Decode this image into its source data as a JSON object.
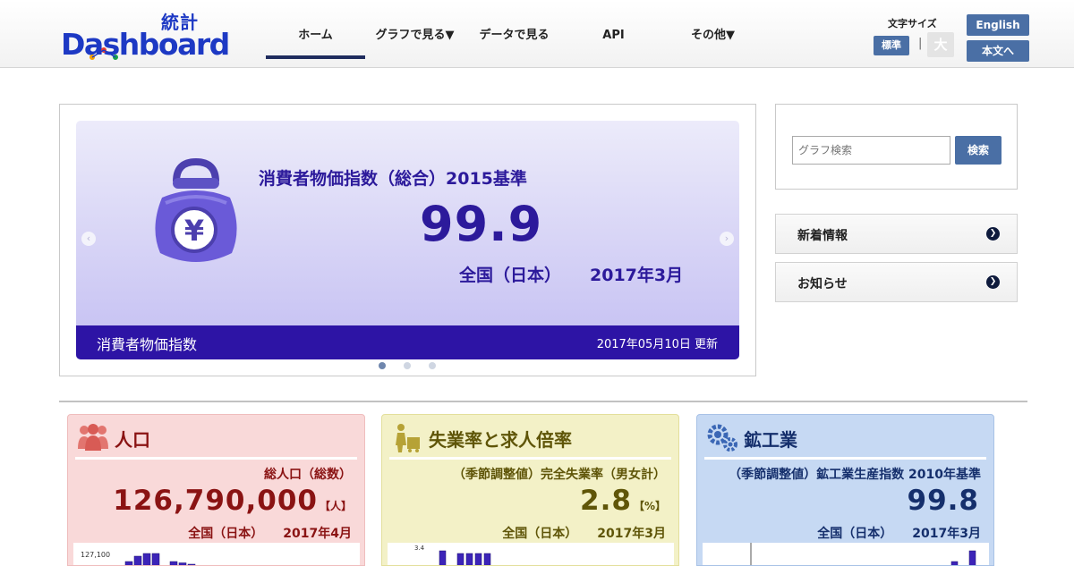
{
  "header": {
    "logo_word": "Dashboard",
    "logo_badge": "統計",
    "nav": [
      {
        "label": "ホーム"
      },
      {
        "label": "グラフで見る▼"
      },
      {
        "label": "データで見る"
      },
      {
        "label": "API"
      },
      {
        "label": "その他▼"
      }
    ],
    "font_size_label": "文字サイズ",
    "font_standard": "標準",
    "font_separator": "|",
    "font_large": "大",
    "english_label": "English",
    "main_content_label": "本文へ"
  },
  "carousel": {
    "title": "消費者物価指数（総合）2015基準",
    "value": "99.9",
    "area": "全国（日本）",
    "date": "2017年3月",
    "category": "消費者物価指数",
    "updated": "2017年05月10日 更新",
    "wallet_symbol": "¥",
    "prev_icon": "‹",
    "next_icon": "›",
    "active_slide": 1,
    "slide_count": 3
  },
  "search": {
    "placeholder": "グラフ検索",
    "button_label": "検索"
  },
  "links": [
    {
      "label": "新着情報",
      "icon": "chevron-right-icon"
    },
    {
      "label": "お知らせ",
      "icon": "chevron-right-icon"
    }
  ],
  "cards": [
    {
      "title": "人口",
      "metric": "総人口（総数）",
      "value": "126,790,000",
      "unit": "【人】",
      "area": "全国（日本）",
      "date": "2017年4月",
      "chart_tick": "127,100",
      "icon": "people-icon",
      "bars": [
        0.3,
        0.5,
        0.6,
        0.6,
        0,
        0.3,
        0.25,
        0.2
      ]
    },
    {
      "title": "失業率と求人倍率",
      "metric": "（季節調整値）完全失業率（男女計）",
      "value": "2.8",
      "unit": "【%】",
      "area": "全国（日本）",
      "date": "2017年3月",
      "chart_tick": "3.4",
      "icon": "worker-icon",
      "bars": [
        0.7,
        0,
        0.6,
        0.6,
        0.6,
        0.6
      ]
    },
    {
      "title": "鉱工業",
      "metric": "（季節調整値）鉱工業生産指数 2010年基準",
      "value": "99.8",
      "unit": "",
      "area": "全国（日本）",
      "date": "2017年3月",
      "chart_tick": "",
      "icon": "gears-icon",
      "bars": [
        0.05,
        0.3,
        0.7
      ]
    }
  ],
  "colors": {
    "brand": "#1d39c4",
    "carousel_footer": "#2d14a5",
    "button": "#4a6fa5",
    "pop_card": "#f9d9d9",
    "unemp_card": "#f3f1c7",
    "ind_card": "#c6d9f3"
  }
}
